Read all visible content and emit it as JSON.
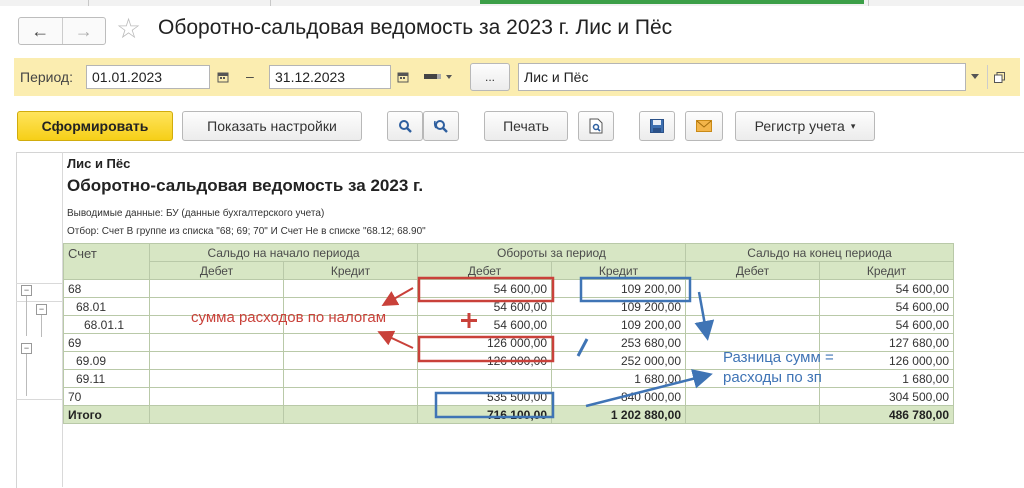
{
  "window": {
    "title": "Оборотно-сальдовая ведомость за 2023 г. Лис и Пёс"
  },
  "nav": {
    "back_glyph": "←",
    "forward_glyph": "→",
    "favorite_glyph": "☆"
  },
  "period": {
    "label": "Период:",
    "from": "01.01.2023",
    "dash": "–",
    "to": "31.12.2023",
    "more_label": "...",
    "organization": "Лис и Пёс"
  },
  "toolbar": {
    "generate": "Сформировать",
    "show_settings": "Показать настройки",
    "print": "Печать",
    "register": "Регистр учета"
  },
  "report": {
    "org": "Лис и Пёс",
    "title": "Оборотно-сальдовая ведомость за 2023 г.",
    "output_data": "Выводимые данные: БУ (данные бухгалтерского учета)",
    "filter": "Отбор: Счет В группе из списка \"68; 69; 70\" И Счет Не в списке \"68.12; 68.90\"",
    "columns": {
      "account": "Счет",
      "opening": "Сальдо на начало периода",
      "turnover": "Обороты за период",
      "closing": "Сальдо на конец периода",
      "debit": "Дебет",
      "credit": "Кредит"
    },
    "rows": [
      {
        "account": "68",
        "turn_debit": "54 600,00",
        "turn_credit": "109 200,00",
        "close_credit": "54 600,00"
      },
      {
        "account": "68.01",
        "turn_debit": "54 600,00",
        "turn_credit": "109 200,00",
        "close_credit": "54 600,00"
      },
      {
        "account": "68.01.1",
        "turn_debit": "54 600,00",
        "turn_credit": "109 200,00",
        "close_credit": "54 600,00"
      },
      {
        "account": "69",
        "turn_debit": "126 000,00",
        "turn_credit": "253 680,00",
        "close_credit": "127 680,00"
      },
      {
        "account": "69.09",
        "turn_debit": "126 000,00",
        "turn_credit": "252 000,00",
        "close_credit": "126 000,00"
      },
      {
        "account": "69.11",
        "turn_debit": "",
        "turn_credit": "1 680,00",
        "close_credit": "1 680,00"
      },
      {
        "account": "70",
        "turn_debit": "535 500,00",
        "turn_credit": "840 000,00",
        "close_credit": "304 500,00"
      }
    ],
    "total": {
      "label": "Итого",
      "turn_debit": "716 100,00",
      "turn_credit": "1 202 880,00",
      "close_credit": "486 780,00"
    }
  },
  "annotations": {
    "red_text": "сумма расходов по налогам",
    "blue_line1": "Разница сумм =",
    "blue_line2": "расходы по зп",
    "red_color": "#c9413a",
    "blue_color": "#3f74b5"
  }
}
